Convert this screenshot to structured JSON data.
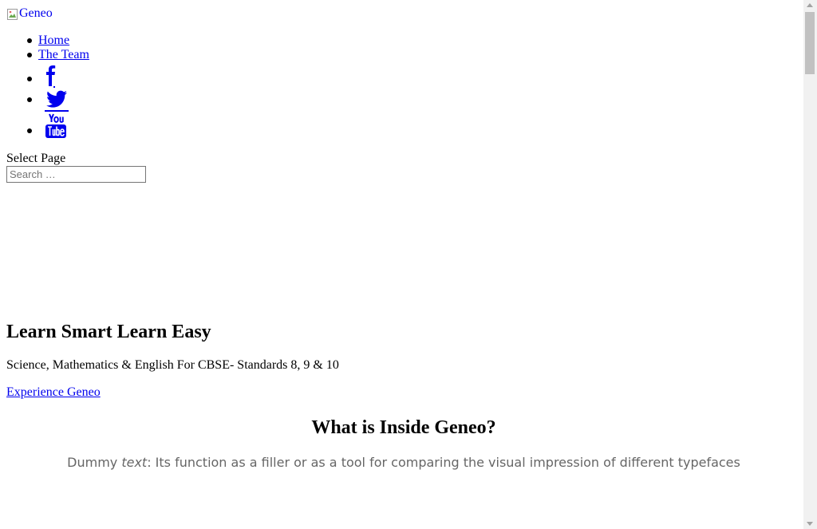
{
  "header": {
    "logo_alt": "Geneo",
    "nav": [
      {
        "label": "Home"
      },
      {
        "label": "The Team"
      }
    ],
    "social": [
      {
        "icon": "facebook-icon"
      },
      {
        "icon": "twitter-icon"
      },
      {
        "icon": "youtube-icon"
      }
    ],
    "select_page": "Select Page",
    "search": {
      "placeholder": "Search …",
      "value": ""
    }
  },
  "hero": {
    "title": "Learn Smart Learn Easy",
    "subtitle": "Science,  Mathematics & English For CBSE- Standards 8, 9 & 10",
    "cta": "Experience Geneo"
  },
  "section": {
    "title": "What is Inside Geneo?",
    "desc_prefix": "Dummy ",
    "desc_em": "text",
    "desc_rest": ": Its function as a filler or as a tool for comparing the visual impression of different typefaces"
  },
  "colors": {
    "link": "#0000ee",
    "muted_text": "#666666"
  }
}
